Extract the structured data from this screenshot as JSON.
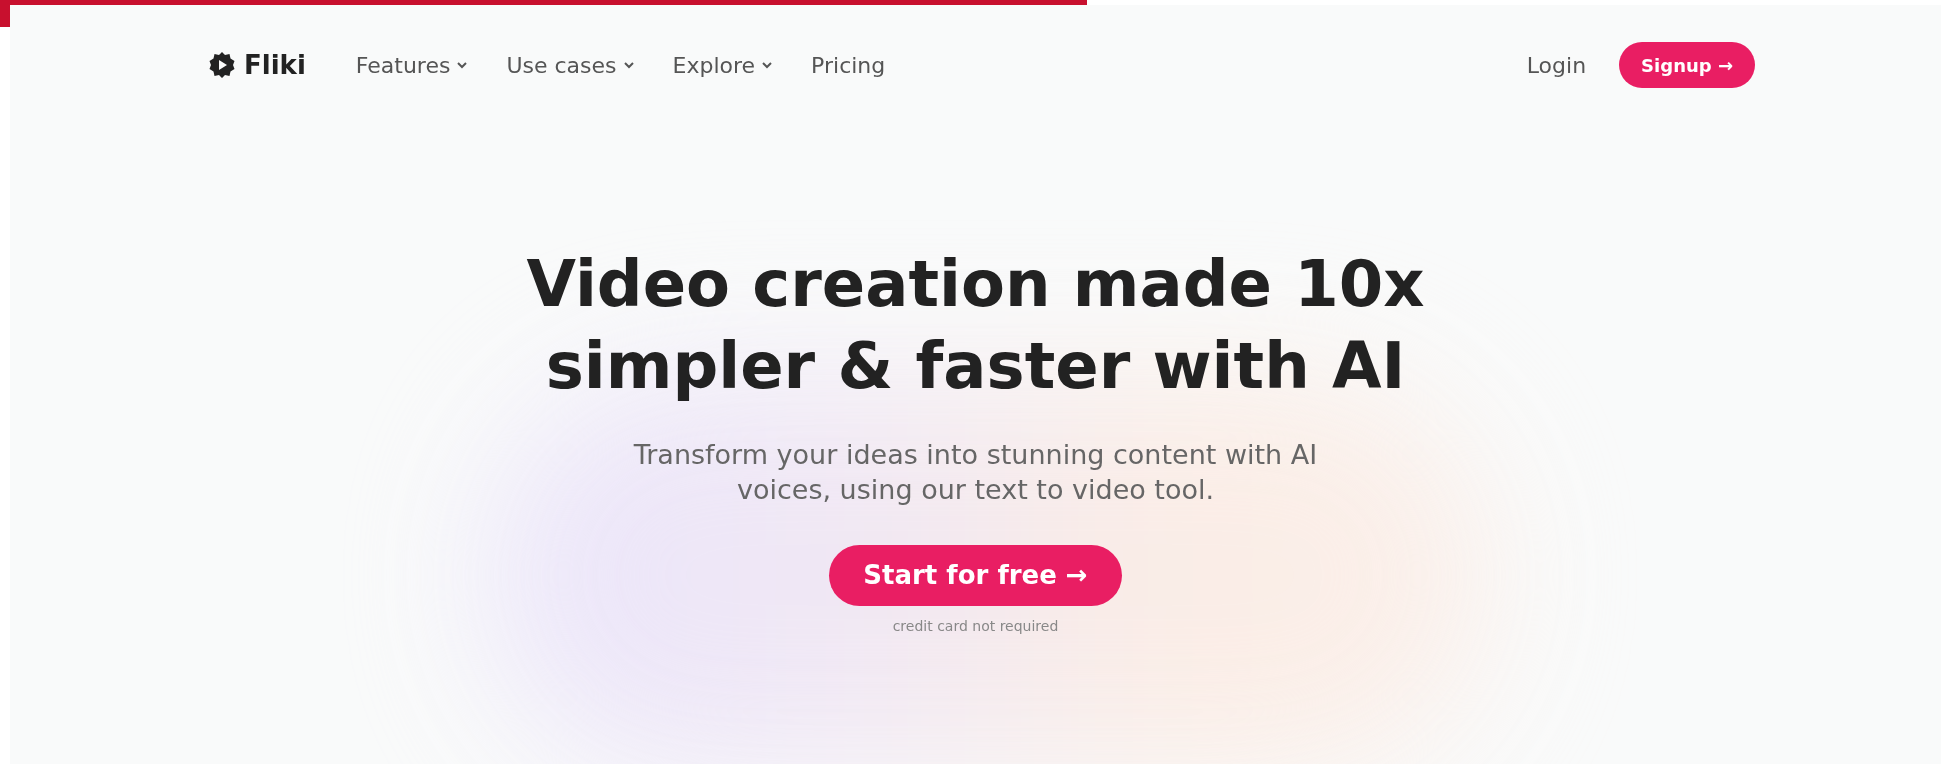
{
  "loading_bar": {
    "level": 0.56
  },
  "nav": {
    "logo": "Fliki",
    "items": [
      {
        "label": "Features",
        "dropdown": true
      },
      {
        "label": "Use cases",
        "dropdown": true
      },
      {
        "label": "Explore",
        "dropdown": true
      },
      {
        "label": "Pricing",
        "dropdown": false
      }
    ],
    "login": "Login",
    "signup": "Signup →"
  },
  "hero": {
    "title_lines": [
      "Video creation made 10x",
      "simpler & faster with AI"
    ],
    "subtitle": "Transform your ideas into stunning content with AI voices, using our text to video tool.",
    "cta": "Start for free →",
    "note": "credit card not required"
  }
}
